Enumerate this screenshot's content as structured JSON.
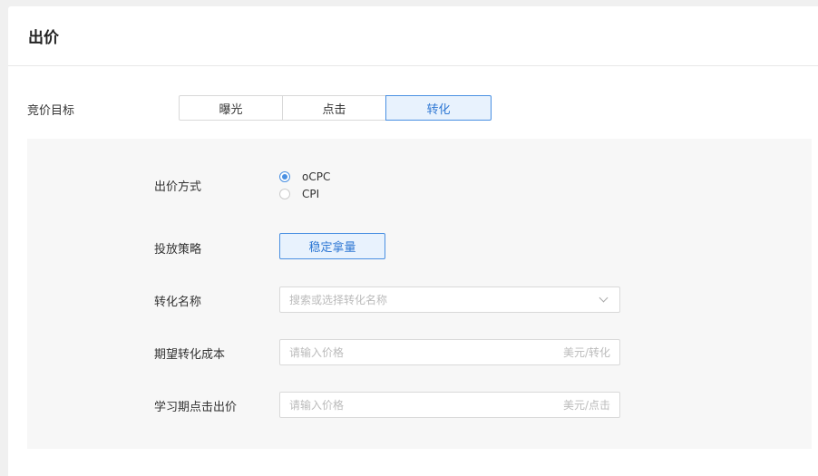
{
  "header": {
    "title": "出价"
  },
  "goal": {
    "label": "竞价目标",
    "options": [
      "曝光",
      "点击",
      "转化"
    ],
    "selected": "转化"
  },
  "bid_method": {
    "label": "出价方式",
    "options": [
      "oCPC",
      "CPI"
    ],
    "selected": "oCPC"
  },
  "strategy": {
    "label": "投放策略",
    "button": "稳定拿量"
  },
  "conversion_name": {
    "label": "转化名称",
    "placeholder": "搜索或选择转化名称",
    "icon": "chevron-down-icon"
  },
  "target_cost": {
    "label": "期望转化成本",
    "placeholder": "请输入价格",
    "suffix": "美元/转化"
  },
  "learning_bid": {
    "label": "学习期点击出价",
    "placeholder": "请输入价格",
    "suffix": "美元/点击"
  },
  "colors": {
    "accent": "#4a90e2",
    "accent_bg": "#e8f2fd",
    "panel_bg": "#f7f7f7",
    "page_bg": "#f0f0f0"
  }
}
